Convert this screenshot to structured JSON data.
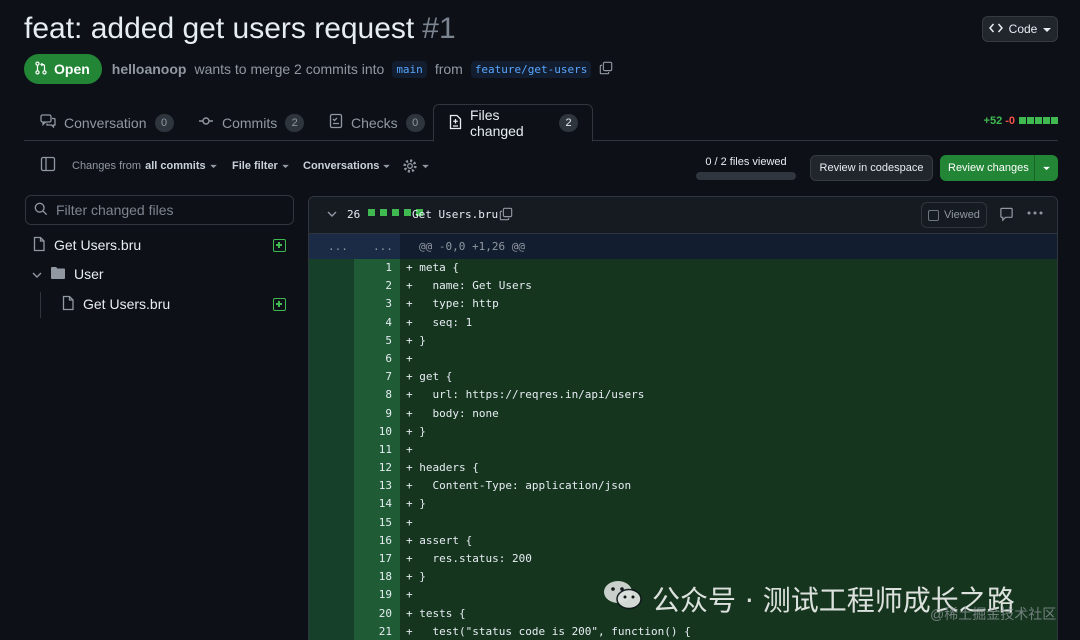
{
  "pr": {
    "title": "feat: added get users request",
    "number": "#1",
    "status": "Open",
    "author": "helloanoop",
    "merge_text_1": "wants to merge 2 commits into",
    "base_branch": "main",
    "from_text": "from",
    "head_branch": "feature/get-users"
  },
  "code_button": {
    "label": "Code"
  },
  "tabs": [
    {
      "label": "Conversation",
      "count": "0",
      "icon": "comment-discussion-icon"
    },
    {
      "label": "Commits",
      "count": "2",
      "icon": "git-commit-icon"
    },
    {
      "label": "Checks",
      "count": "0",
      "icon": "checklist-icon"
    },
    {
      "label": "Files changed",
      "count": "2",
      "icon": "file-diff-icon",
      "active": true
    }
  ],
  "diffstat": {
    "additions": "+52",
    "deletions": "-0"
  },
  "toolbar": {
    "changes_prefix": "Changes from",
    "changes_value": "all commits",
    "file_filter": "File filter",
    "conversations": "Conversations",
    "files_viewed": "0 / 2 files viewed",
    "files_viewed_fraction": 0,
    "codespace": "Review in codespace",
    "review": "Review changes"
  },
  "sidebar": {
    "filter_placeholder": "Filter changed files",
    "tree": [
      {
        "type": "file",
        "label": "Get Users.bru",
        "status": "added"
      },
      {
        "type": "folder",
        "label": "User"
      },
      {
        "type": "file",
        "label": "Get Users.bru",
        "status": "added",
        "nested": true
      }
    ]
  },
  "diff": {
    "lines_changed": "26",
    "filename": "Get Users.bru",
    "viewed_label": "Viewed",
    "hunk_dots_1": "...",
    "hunk_dots_2": "...",
    "hunk_header": "@@ -0,0 +1,26 @@",
    "lines": [
      {
        "n": "1",
        "code": "+ meta {"
      },
      {
        "n": "2",
        "code": "+   name: Get Users"
      },
      {
        "n": "3",
        "code": "+   type: http"
      },
      {
        "n": "4",
        "code": "+   seq: 1"
      },
      {
        "n": "5",
        "code": "+ }"
      },
      {
        "n": "6",
        "code": "+"
      },
      {
        "n": "7",
        "code": "+ get {"
      },
      {
        "n": "8",
        "code": "+   url: https://reqres.in/api/users"
      },
      {
        "n": "9",
        "code": "+   body: none"
      },
      {
        "n": "10",
        "code": "+ }"
      },
      {
        "n": "11",
        "code": "+"
      },
      {
        "n": "12",
        "code": "+ headers {"
      },
      {
        "n": "13",
        "code": "+   Content-Type: application/json"
      },
      {
        "n": "14",
        "code": "+ }"
      },
      {
        "n": "15",
        "code": "+"
      },
      {
        "n": "16",
        "code": "+ assert {"
      },
      {
        "n": "17",
        "code": "+   res.status: 200"
      },
      {
        "n": "18",
        "code": "+ }"
      },
      {
        "n": "19",
        "code": "+"
      },
      {
        "n": "20",
        "code": "+ tests {"
      },
      {
        "n": "21",
        "code": "+   test(\"status code is 200\", function() {"
      }
    ]
  },
  "watermark": {
    "text": "公众号 · 测试工程师成长之路",
    "sub": "@稀土掘金技术社区"
  }
}
